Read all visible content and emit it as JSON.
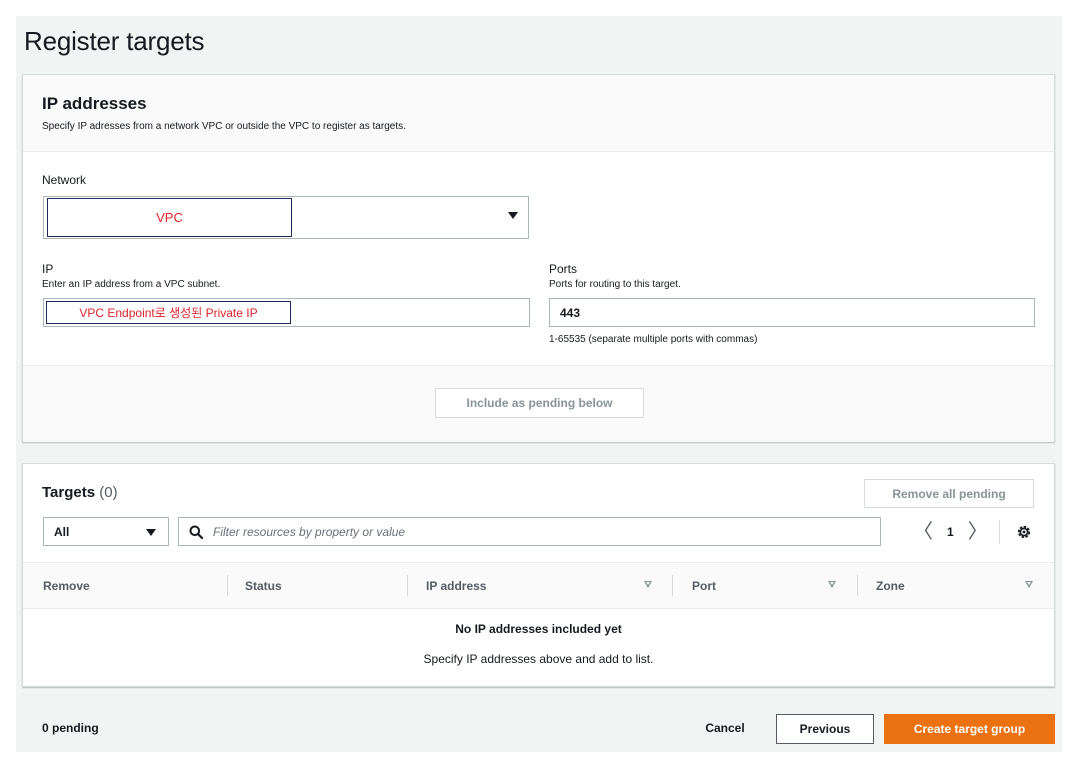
{
  "page": {
    "title": "Register targets"
  },
  "ip_panel": {
    "title": "IP addresses",
    "description": "Specify IP adresses from a network VPC or outside the VPC to register as targets.",
    "network": {
      "label": "Network",
      "value": "VPC"
    },
    "ip": {
      "label": "IP",
      "description": "Enter an IP address from a VPC subnet.",
      "value": "VPC Endpoint로 생성된 Private IP"
    },
    "ports": {
      "label": "Ports",
      "description": "Ports for routing to this target.",
      "value": "443",
      "hint": "1-65535 (separate multiple ports with commas)"
    },
    "include_button": "Include as pending below"
  },
  "targets_panel": {
    "title": "Targets",
    "count": "(0)",
    "remove_all_button": "Remove all pending",
    "filter_select": "All",
    "search_placeholder": "Filter resources by property or value",
    "pager": {
      "prev": "〈",
      "page": "1",
      "next": "〉"
    },
    "columns": [
      "Remove",
      "Status",
      "IP address",
      "Port",
      "Zone"
    ],
    "empty_title": "No IP addresses included yet",
    "empty_description": "Specify IP addresses above and add to list."
  },
  "footer": {
    "pending": "0 pending",
    "cancel": "Cancel",
    "previous": "Previous",
    "create": "Create target group"
  },
  "colors": {
    "primary": "#ec7211",
    "annotation_text": "#e0222b",
    "annotation_border": "#1d2a5c"
  }
}
